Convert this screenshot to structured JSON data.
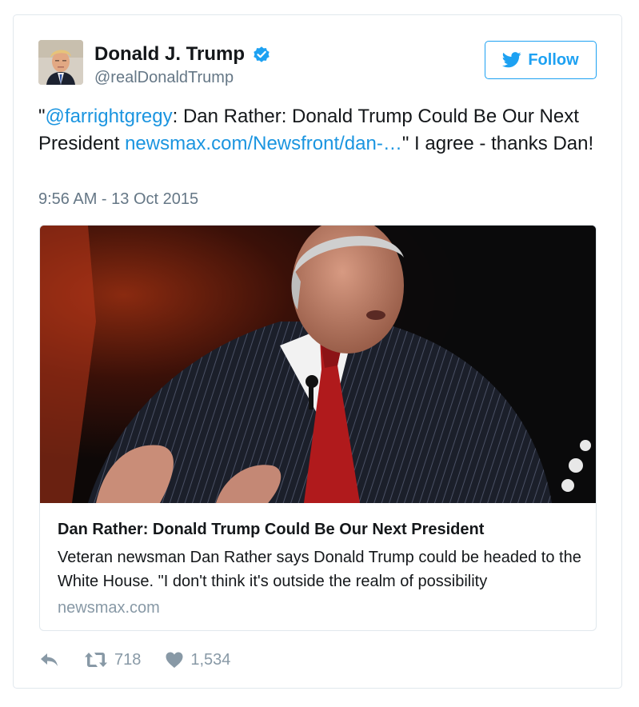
{
  "tweet": {
    "author": {
      "name": "Donald J. Trump",
      "handle": "@realDonaldTrump",
      "verified_icon": "verified-badge-icon",
      "avatar": "profile-photo"
    },
    "follow": {
      "label": "Follow",
      "icon": "twitter-bird-icon"
    },
    "text": {
      "quote_open": "\"",
      "mention": "@farrightgregy",
      "body": ": Dan Rather: Donald Trump Could Be Our Next President ",
      "link": "newsmax.com/Newsfront/dan-…",
      "closing": "\" I agree - thanks Dan!"
    },
    "timestamp": "9:56 AM - 13 Oct 2015",
    "card": {
      "image": "man-in-pinstripe-suit-speaking",
      "title": "Dan Rather: Donald Trump Could Be Our Next President",
      "description": "Veteran newsman Dan Rather says Donald Trump could be headed to the White House. \"I don't think it's outside the realm of possibility",
      "domain": "newsmax.com"
    },
    "actions": {
      "reply_icon": "reply-icon",
      "retweet_icon": "retweet-icon",
      "retweets": "718",
      "like_icon": "heart-icon",
      "likes": "1,534"
    }
  },
  "colors": {
    "link": "#1b95e0",
    "accent": "#1da1f2",
    "secondary_text": "#657786",
    "border": "#e1e8ed"
  }
}
